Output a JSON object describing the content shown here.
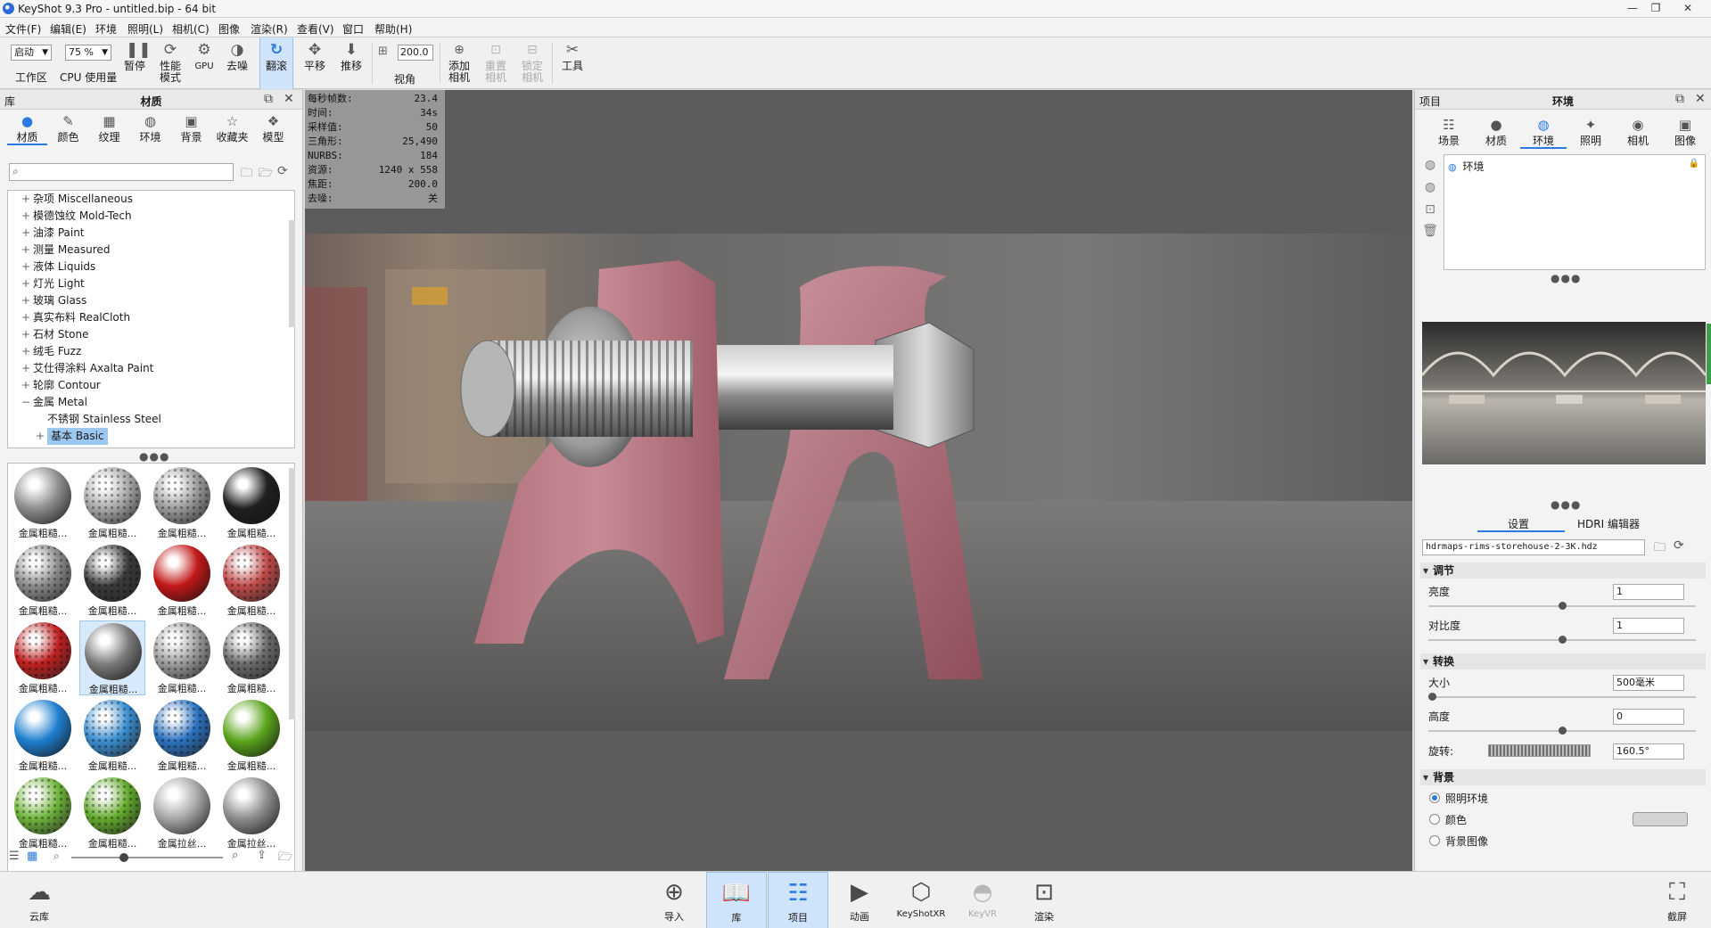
{
  "window": {
    "title": "KeyShot 9.3 Pro  - untitled.bip  - 64 bit",
    "controls": [
      "—",
      "❐",
      "✕"
    ]
  },
  "menu": [
    "文件(F)",
    "编辑(E)",
    "环境",
    "照明(L)",
    "相机(C)",
    "图像",
    "渲染(R)",
    "查看(V)",
    "窗口",
    "帮助(H)"
  ],
  "toolbar": {
    "workspace_value": "启动",
    "workspace_label": "工作区",
    "cpu_value": "75 %",
    "cpu_label": "CPU 使用量",
    "pause": "暂停",
    "perf_mode_l1": "性能",
    "perf_mode_l2": "模式",
    "gpu": "GPU",
    "denoise": "去噪",
    "tumble": "翻滚",
    "pan": "平移",
    "dolly": "推移",
    "fov_value": "200.0",
    "fov_label": "视角",
    "add_camera_l1": "添加",
    "add_camera_l2": "相机",
    "reset_camera_l1": "重置",
    "reset_camera_l2": "相机",
    "lock_camera_l1": "锁定",
    "lock_camera_l2": "相机",
    "tools": "工具"
  },
  "library": {
    "panel_label": "库",
    "panel_title": "材质",
    "tabs": [
      {
        "label": "材质",
        "icon": "material-icon"
      },
      {
        "label": "颜色",
        "icon": "color-icon"
      },
      {
        "label": "纹理",
        "icon": "texture-icon"
      },
      {
        "label": "环境",
        "icon": "environment-icon"
      },
      {
        "label": "背景",
        "icon": "background-icon"
      },
      {
        "label": "收藏夹",
        "icon": "favorites-icon"
      },
      {
        "label": "模型",
        "icon": "model-icon"
      }
    ],
    "search_placeholder": "",
    "tree": [
      {
        "sign": "+",
        "label": "杂项 Miscellaneous",
        "indent": 0
      },
      {
        "sign": "+",
        "label": "模德蚀纹 Mold-Tech",
        "indent": 0
      },
      {
        "sign": "+",
        "label": "油漆 Paint",
        "indent": 0
      },
      {
        "sign": "+",
        "label": "测量 Measured",
        "indent": 0
      },
      {
        "sign": "+",
        "label": "液体 Liquids",
        "indent": 0
      },
      {
        "sign": "+",
        "label": "灯光 Light",
        "indent": 0
      },
      {
        "sign": "+",
        "label": "玻璃 Glass",
        "indent": 0
      },
      {
        "sign": "+",
        "label": "真实布料 RealCloth",
        "indent": 0
      },
      {
        "sign": "+",
        "label": "石材 Stone",
        "indent": 0
      },
      {
        "sign": "+",
        "label": "绒毛 Fuzz",
        "indent": 0
      },
      {
        "sign": "+",
        "label": "艾仕得涂料 Axalta Paint",
        "indent": 0
      },
      {
        "sign": "+",
        "label": "轮廓 Contour",
        "indent": 0
      },
      {
        "sign": "−",
        "label": "金属 Metal",
        "indent": 0
      },
      {
        "sign": "",
        "label": "不锈钢 Stainless Steel",
        "indent": 1
      },
      {
        "sign": "+",
        "label": "基本 Basic",
        "indent": 1,
        "selected": true
      }
    ],
    "thumbnails": [
      {
        "caption": "金属粗糙...",
        "color": "#8e8e8e",
        "style": "swirl"
      },
      {
        "caption": "金属粗糙...",
        "color": "#a9a9a9",
        "style": "mesh"
      },
      {
        "caption": "金属粗糙...",
        "color": "#9b9b9b",
        "style": "mesh"
      },
      {
        "caption": "金属粗糙...",
        "color": "#202020",
        "style": "swirl"
      },
      {
        "caption": "金属粗糙...",
        "color": "#8a8a8a",
        "style": "mesh"
      },
      {
        "caption": "金属粗糙...",
        "color": "#3a3a3a",
        "style": "mesh"
      },
      {
        "caption": "金属粗糙...",
        "color": "#c21818",
        "style": "swirl"
      },
      {
        "caption": "金属粗糙...",
        "color": "#c24a4a",
        "style": "mesh"
      },
      {
        "caption": "金属粗糙...",
        "color": "#c02020",
        "style": "mesh"
      },
      {
        "caption": "金属粗糙...",
        "color": "#7a7a7a",
        "style": "swirl",
        "selected": true
      },
      {
        "caption": "金属粗糙...",
        "color": "#9d9d9d",
        "style": "mesh"
      },
      {
        "caption": "金属粗糙...",
        "color": "#6c6c6c",
        "style": "mesh"
      },
      {
        "caption": "金属粗糙...",
        "color": "#1f7fcf",
        "style": "swirl"
      },
      {
        "caption": "金属粗糙...",
        "color": "#3a8ed0",
        "style": "mesh"
      },
      {
        "caption": "金属粗糙...",
        "color": "#2b72c0",
        "style": "mesh"
      },
      {
        "caption": "金属粗糙...",
        "color": "#5aa51c",
        "style": "swirl"
      },
      {
        "caption": "金属粗糙...",
        "color": "#6eb43a",
        "style": "mesh"
      },
      {
        "caption": "金属粗糙...",
        "color": "#62aa2c",
        "style": "mesh"
      },
      {
        "caption": "金属拉丝...",
        "color": "#a6a6a6",
        "style": "swirl"
      },
      {
        "caption": "金属拉丝...",
        "color": "#8d8d8d",
        "style": "swirl"
      }
    ]
  },
  "stats": [
    {
      "label": "每秒帧数:",
      "value": "23.4"
    },
    {
      "label": "时间:",
      "value": "34s"
    },
    {
      "label": "采样值:",
      "value": "50"
    },
    {
      "label": "三角形:",
      "value": "25,490"
    },
    {
      "label": "NURBS:",
      "value": "184"
    },
    {
      "label": "资源:",
      "value": "1240 x 558"
    },
    {
      "label": "焦距:",
      "value": "200.0"
    },
    {
      "label": "去噪:",
      "value": "关"
    }
  ],
  "project": {
    "panel_label": "项目",
    "panel_title": "环境",
    "tabs": [
      {
        "label": "场景",
        "icon": "scene-icon"
      },
      {
        "label": "材质",
        "icon": "material-icon"
      },
      {
        "label": "环境",
        "icon": "environment-icon"
      },
      {
        "label": "照明",
        "icon": "lighting-icon"
      },
      {
        "label": "相机",
        "icon": "camera-icon"
      },
      {
        "label": "图像",
        "icon": "image-icon"
      }
    ],
    "env_item": "环境",
    "subtabs": {
      "settings": "设置",
      "hdri_editor": "HDRI 编辑器"
    },
    "hdri_file": "hdrmaps-rims-storehouse-2-3K.hdz",
    "adjust": {
      "title": "调节",
      "brightness_label": "亮度",
      "brightness_value": "1",
      "brightness_pos": 0.5,
      "contrast_label": "对比度",
      "contrast_value": "1",
      "contrast_pos": 0.5
    },
    "transform": {
      "title": "转换",
      "size_label": "大小",
      "size_value": "500毫米",
      "size_pos": 0.0,
      "height_label": "高度",
      "height_value": "0",
      "height_pos": 0.5,
      "rotation_label": "旋转:",
      "rotation_value": "160.5°"
    },
    "background": {
      "title": "背景",
      "options": [
        {
          "label": "照明环境",
          "checked": true
        },
        {
          "label": "颜色",
          "checked": false
        },
        {
          "label": "背景图像",
          "checked": false
        }
      ],
      "color_swatch": "#d4d4d4"
    }
  },
  "bottombar": {
    "cloud": "云库",
    "import": "导入",
    "library": "库",
    "project": "项目",
    "animation": "动画",
    "keyshotxr": "KeyShotXR",
    "keyvr": "KeyVR",
    "render": "渲染",
    "screenshot": "截屏"
  }
}
